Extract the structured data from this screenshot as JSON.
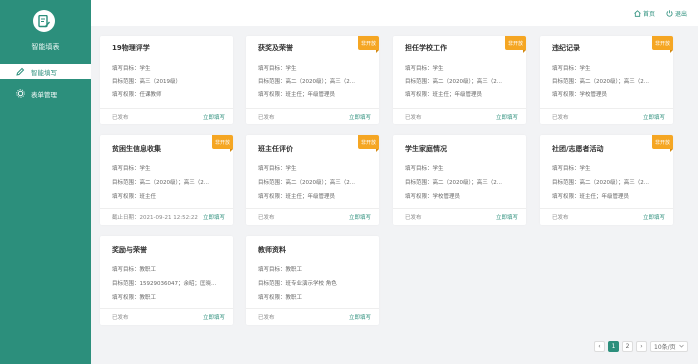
{
  "app": {
    "title": "智能填表"
  },
  "sidebar": {
    "items": [
      {
        "label": "智能填写",
        "icon": "pen-icon"
      },
      {
        "label": "表单管理",
        "icon": "gear-icon"
      }
    ]
  },
  "topbar": {
    "home_label": "首页",
    "logout_label": "退出"
  },
  "colors": {
    "accent": "#2c8f7c",
    "ribbon": "#f5a623"
  },
  "cards": [
    {
      "title": "19物理评学",
      "ribbon": "",
      "l1": "填写目标：学生",
      "l2": "目标范围：高三（2019级）",
      "l3": "填写权限：任课教师",
      "status": "已发布",
      "action": "立即填写"
    },
    {
      "title": "获奖及荣誉",
      "ribbon": "非开放",
      "l1": "填写目标：学生",
      "l2": "目标范围：高二（2020级）；高三（2...",
      "l3": "填写权限：班主任；年级管理员",
      "status": "已发布",
      "action": "立即填写"
    },
    {
      "title": "担任学校工作",
      "ribbon": "非开放",
      "l1": "填写目标：学生",
      "l2": "目标范围：高二（2020级）；高三（2...",
      "l3": "填写权限：班主任；年级管理员",
      "status": "已发布",
      "action": "立即填写"
    },
    {
      "title": "违纪记录",
      "ribbon": "非开放",
      "l1": "填写目标：学生",
      "l2": "目标范围：高二（2020级）；高三（2...",
      "l3": "填写权限：学校管理员",
      "status": "已发布",
      "action": "立即填写"
    },
    {
      "title": "贫困生信息收集",
      "ribbon": "非开放",
      "l1": "填写目标：学生",
      "l2": "目标范围：高二（2020级）；高三（2...",
      "l3": "填写权限：班主任",
      "status": "截止日期：2021-09-21 12:52:22",
      "action": "立即填写"
    },
    {
      "title": "班主任评价",
      "ribbon": "非开放",
      "l1": "填写目标：学生",
      "l2": "目标范围：高二（2020级）；高三（2...",
      "l3": "填写权限：班主任；年级管理员",
      "status": "已发布",
      "action": "立即填写"
    },
    {
      "title": "学生家庭情况",
      "ribbon": "",
      "l1": "填写目标：学生",
      "l2": "目标范围：高二（2020级）；高三（2...",
      "l3": "填写权限：学校管理员",
      "status": "已发布",
      "action": "立即填写"
    },
    {
      "title": "社团/志愿者活动",
      "ribbon": "非开放",
      "l1": "填写目标：学生",
      "l2": "目标范围：高二（2020级）；高三（2...",
      "l3": "填写权限：班主任；年级管理员",
      "status": "已发布",
      "action": "立即填写"
    },
    {
      "title": "奖励与荣誉",
      "ribbon": "",
      "l1": "填写目标：教职工",
      "l2": "目标范围：15929036047；余昭；匡晓...",
      "l3": "填写权限：教职工",
      "status": "已发布",
      "action": "立即填写"
    },
    {
      "title": "教师资料",
      "ribbon": "",
      "l1": "填写目标：教职工",
      "l2": "目标范围：班专业演示学校 角色",
      "l3": "填写权限：教职工",
      "status": "已发布",
      "action": "立即填写"
    }
  ],
  "pagination": {
    "prev": "‹",
    "pages": [
      "1",
      "2"
    ],
    "next": "›",
    "page_size": "10条/页"
  }
}
